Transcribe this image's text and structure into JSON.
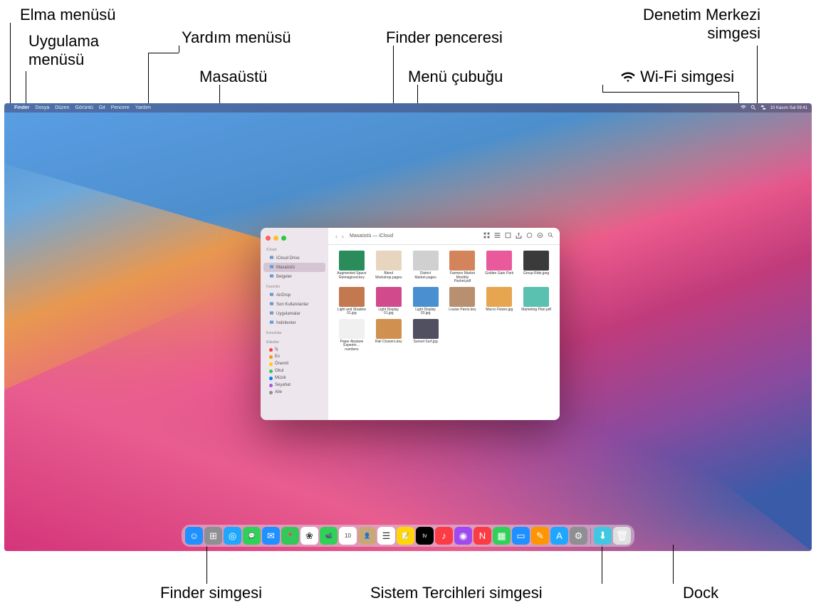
{
  "annotations": {
    "apple_menu": "Elma menüsü",
    "app_menu": "Uygulama\nmenüsü",
    "help_menu": "Yardım menüsü",
    "desktop": "Masaüstü",
    "finder_window": "Finder penceresi",
    "menu_bar": "Menü çubuğu",
    "wifi_icon": "Wi-Fi simgesi",
    "control_center": "Denetim Merkezi\nsimgesi",
    "finder_icon": "Finder simgesi",
    "sysprefs_icon": "Sistem Tercihleri simgesi",
    "dock": "Dock"
  },
  "menubar": {
    "items": [
      "Finder",
      "Dosya",
      "Düzen",
      "Görüntü",
      "Git",
      "Pencere",
      "Yardım"
    ],
    "datetime": "10 Kasım Sal  09:41"
  },
  "finder": {
    "title": "Masaüstü — iCloud",
    "sidebar_sections": [
      {
        "label": "iCloud",
        "items": [
          {
            "label": "iCloud Drive",
            "icon": "cloud"
          },
          {
            "label": "Masaüstü",
            "icon": "desktop",
            "selected": true
          },
          {
            "label": "Belgeler",
            "icon": "doc"
          }
        ]
      },
      {
        "label": "Favoriler",
        "items": [
          {
            "label": "AirDrop",
            "icon": "airdrop"
          },
          {
            "label": "Son Kullanılanlar",
            "icon": "clock"
          },
          {
            "label": "Uygulamalar",
            "icon": "apps"
          },
          {
            "label": "İndirilenler",
            "icon": "download"
          }
        ]
      },
      {
        "label": "Konumlar",
        "items": []
      },
      {
        "label": "Etiketler",
        "items": [
          {
            "label": "İş",
            "color": "#ff3b30"
          },
          {
            "label": "Ev",
            "color": "#ff9500"
          },
          {
            "label": "Önemli",
            "color": "#ffcc00"
          },
          {
            "label": "Okul",
            "color": "#34c759"
          },
          {
            "label": "Müzik",
            "color": "#007aff"
          },
          {
            "label": "Seyahat",
            "color": "#af52de"
          },
          {
            "label": "Aile",
            "color": "#8e8e93"
          }
        ]
      }
    ],
    "files": [
      {
        "name": "Augmented Space Reimagined.key",
        "color": "#2a8c5a"
      },
      {
        "name": "Blend Workshop.pages",
        "color": "#e8d5c0"
      },
      {
        "name": "District Market.pages",
        "color": "#d0d0d0"
      },
      {
        "name": "Farmers Market Monthly Packet.pdf",
        "color": "#d4845a"
      },
      {
        "name": "Golden Gate Park",
        "color": "#e85a9c"
      },
      {
        "name": "Group Ride.jpeg",
        "color": "#3a3a3a"
      },
      {
        "name": "Light and Shadow 01.jpg",
        "color": "#c47850"
      },
      {
        "name": "Light Display 01.jpg",
        "color": "#d04a8c"
      },
      {
        "name": "Light Display 03.jpg",
        "color": "#4a90d0"
      },
      {
        "name": "Louise Parris.key",
        "color": "#b89070"
      },
      {
        "name": "Macro Flower.jpg",
        "color": "#e8a550"
      },
      {
        "name": "Marketing Plan.pdf",
        "color": "#5ac0b0"
      },
      {
        "name": "Paper Airplane Experim…numbers",
        "color": "#f0f0f0"
      },
      {
        "name": "Rail Chasers.key",
        "color": "#d09050"
      },
      {
        "name": "Sunset Surf.jpg",
        "color": "#505060"
      }
    ]
  },
  "dock": {
    "icons": [
      {
        "name": "finder",
        "color": "#1e90ff",
        "glyph": "☺"
      },
      {
        "name": "launchpad",
        "color": "#8e8e93",
        "glyph": "⊞"
      },
      {
        "name": "safari",
        "color": "#1ea7fd",
        "glyph": "◎"
      },
      {
        "name": "messages",
        "color": "#30d158",
        "glyph": "💬"
      },
      {
        "name": "mail",
        "color": "#1e90ff",
        "glyph": "✉"
      },
      {
        "name": "maps",
        "color": "#34c759",
        "glyph": "📍"
      },
      {
        "name": "photos",
        "color": "#fff",
        "glyph": "❀"
      },
      {
        "name": "facetime",
        "color": "#30d158",
        "glyph": "📹"
      },
      {
        "name": "calendar",
        "color": "#fff",
        "glyph": "10"
      },
      {
        "name": "contacts",
        "color": "#c8a878",
        "glyph": "👤"
      },
      {
        "name": "reminders",
        "color": "#fff",
        "glyph": "☰"
      },
      {
        "name": "notes",
        "color": "#ffd60a",
        "glyph": "📝"
      },
      {
        "name": "tv",
        "color": "#000",
        "glyph": "tv"
      },
      {
        "name": "music",
        "color": "#fc3c44",
        "glyph": "♪"
      },
      {
        "name": "podcasts",
        "color": "#9f4af0",
        "glyph": "◉"
      },
      {
        "name": "news",
        "color": "#fc3c44",
        "glyph": "N"
      },
      {
        "name": "numbers",
        "color": "#30d158",
        "glyph": "▦"
      },
      {
        "name": "keynote",
        "color": "#1e90ff",
        "glyph": "▭"
      },
      {
        "name": "pages",
        "color": "#ff9500",
        "glyph": "✎"
      },
      {
        "name": "appstore",
        "color": "#1ea7fd",
        "glyph": "A"
      },
      {
        "name": "sysprefs",
        "color": "#8e8e93",
        "glyph": "⚙"
      }
    ],
    "right": [
      {
        "name": "downloads",
        "color": "#40c8e0",
        "glyph": "⬇"
      },
      {
        "name": "trash",
        "color": "#e0e0e0",
        "glyph": "🗑"
      }
    ]
  }
}
